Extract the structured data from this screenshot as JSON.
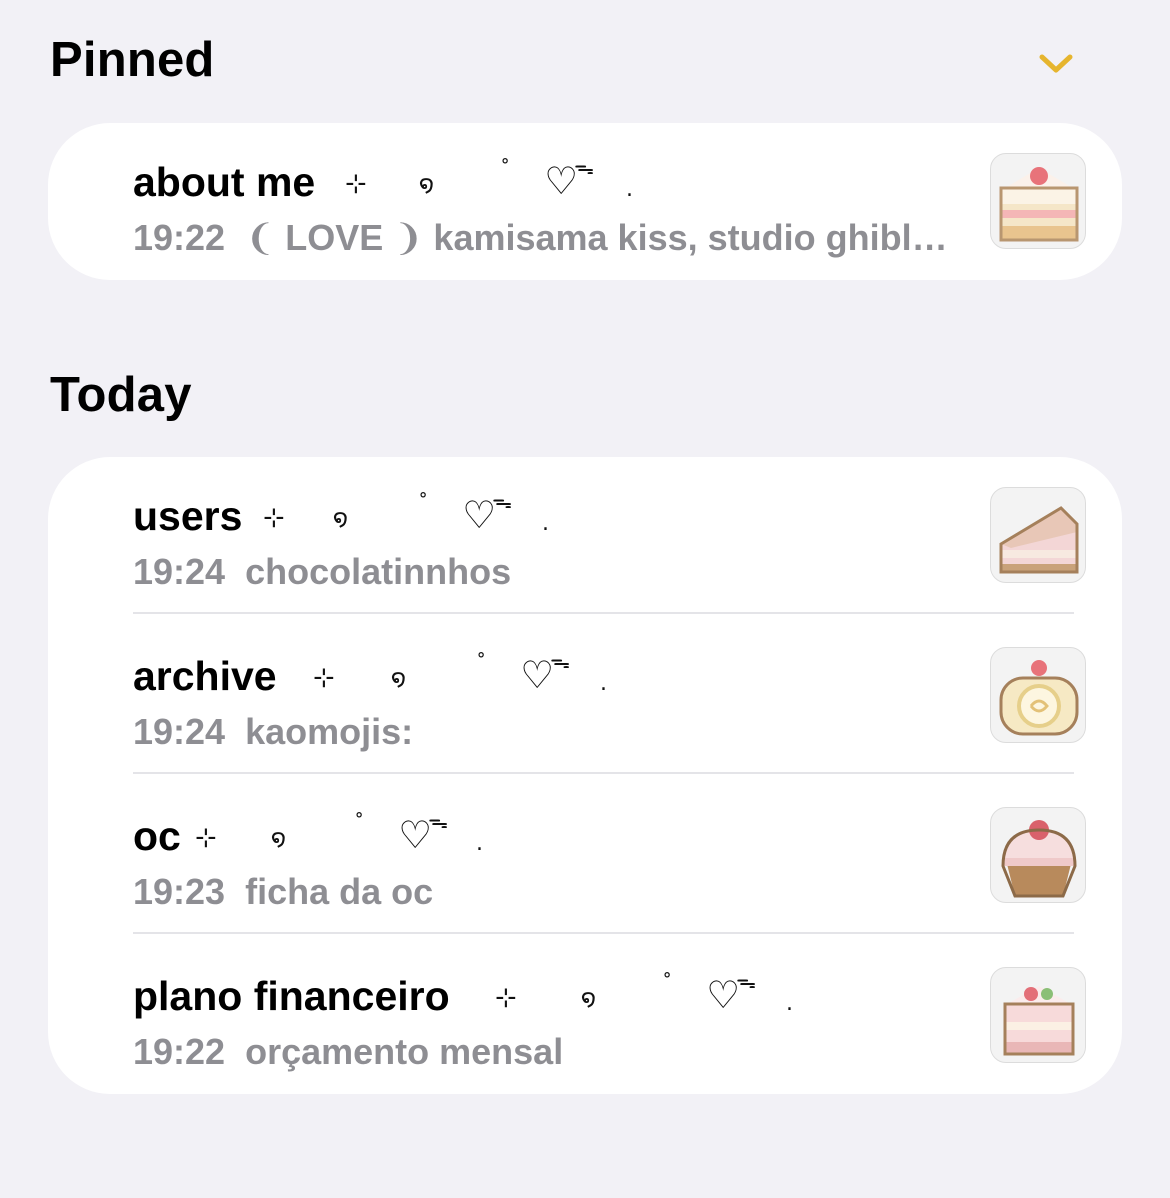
{
  "pinned": {
    "header": "Pinned",
    "toggle_icon": "chevron-down-icon",
    "accent": "#e6b52e",
    "notes": [
      {
        "title": "about me",
        "deco": [
          "⊹",
          "໑",
          "˚",
          "♡",
          "ᯓ",
          "."
        ],
        "time": "19:22",
        "preview": "❨ LOVE ❩ kamisama kiss, studio ghibl…",
        "thumb_icon": "cake-slice-icon"
      }
    ]
  },
  "today": {
    "header": "Today",
    "notes": [
      {
        "title": "users",
        "deco": [
          "⊹",
          "໑",
          "˚",
          "♡",
          "ᯓ",
          "."
        ],
        "time": "19:24",
        "preview": "chocolatinnhos",
        "thumb_icon": "cake-wedge-icon"
      },
      {
        "title": "archive",
        "deco": [
          "⊹",
          "໑",
          "˚",
          "♡",
          "ᯓ",
          "."
        ],
        "time": "19:24",
        "preview": "kaomojis:",
        "thumb_icon": "swiss-roll-icon"
      },
      {
        "title": "oc",
        "deco": [
          "⊹",
          "໑",
          "˚",
          "♡",
          "ᯓ",
          "."
        ],
        "time": "19:23",
        "preview": "ficha da oc",
        "thumb_icon": "cupcake-icon"
      },
      {
        "title": "plano financeiro",
        "deco": [
          "⊹",
          "໑",
          "˚",
          "♡",
          "ᯓ",
          "."
        ],
        "time": "19:22",
        "preview": "orçamento mensal",
        "thumb_icon": "strawberry-cake-icon"
      }
    ]
  }
}
